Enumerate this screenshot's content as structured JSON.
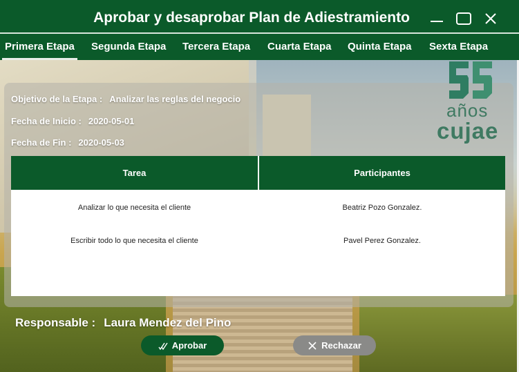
{
  "window": {
    "title": "Aprobar y desaprobar Plan de Adiestramiento"
  },
  "tabs": [
    {
      "label": "Primera Etapa",
      "active": true
    },
    {
      "label": "Segunda Etapa",
      "active": false
    },
    {
      "label": "Tercera Etapa",
      "active": false
    },
    {
      "label": "Cuarta Etapa",
      "active": false
    },
    {
      "label": "Quinta Etapa",
      "active": false
    },
    {
      "label": "Sexta Etapa",
      "active": false
    }
  ],
  "logo": {
    "anos": "años",
    "name": "cujae"
  },
  "stage": {
    "objetivo_label": "Objetivo de la Etapa :",
    "objetivo_value": "Analizar las reglas del negocio",
    "inicio_label": "Fecha de Inicio :",
    "inicio_value": "2020-05-01",
    "fin_label": "Fecha de Fin :",
    "fin_value": "2020-05-03"
  },
  "table": {
    "headers": [
      "Tarea",
      "Participantes"
    ],
    "rows": [
      [
        "Analizar lo que necesita el cliente",
        "Beatriz Pozo Gonzalez."
      ],
      [
        "Escribir todo lo que necesita el cliente",
        "Pavel Perez Gonzalez."
      ]
    ]
  },
  "responsable": {
    "label": "Responsable :",
    "value": "Laura Mendez del Pino"
  },
  "buttons": {
    "aprobar": "Aprobar",
    "rechazar": "Rechazar"
  },
  "colors": {
    "primary_green": "#0b5a2a",
    "reject_gray": "#8a8a88",
    "logo_green": "#3f7a62"
  }
}
